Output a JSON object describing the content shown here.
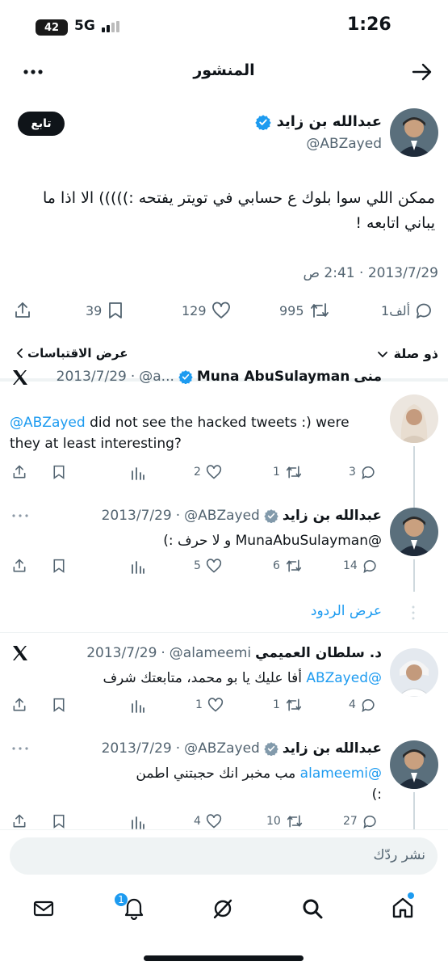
{
  "status_bar": {
    "time": "1:26",
    "battery": "42",
    "network": "5G"
  },
  "header": {
    "title": "المنشور"
  },
  "main_tweet": {
    "author_name": "عبدالله بن زايد",
    "handle": "@ABZayed",
    "follow_label": "تابع",
    "text_line1": "ممكن اللي سوا بلوك ع حسابي في تويتر يفتحه :))))) الا اذا ما",
    "text_line2": "يباني اتابعه !",
    "timestamp": "2013/7/29 · 2:41 ص",
    "replies": "1ألف",
    "retweets": "995",
    "likes": "129",
    "bookmarks": "39",
    "relevance_label": "ذو صلة",
    "quotes_label": "عرض الاقتباسات"
  },
  "replies": [
    {
      "author_name": "منى",
      "author_name_latin": "Muna AbuSulayman",
      "handle": "@a...",
      "date": "2013/7/29",
      "text_mention": "@ABZayed",
      "text_line1": " did not see the hacked tweets :) were",
      "text_line2": "they at least interesting?",
      "replies": "3",
      "retweets": "1",
      "likes": "2"
    },
    {
      "author_name": "عبدالله بن زايد",
      "handle": "@ABZayed",
      "date": "2013/7/29",
      "text": "@MunaAbuSulayman و لا حرف :)",
      "replies": "14",
      "retweets": "6",
      "likes": "5",
      "show_replies": "عرض الردود"
    },
    {
      "author_name": "د. سلطان العميمي",
      "handle": "@alameemi",
      "date": "2013/7/29",
      "text_mention": "@ABZayed",
      "text_rest": " أفا عليك يا بو محمد، متابعتك شرف",
      "replies": "4",
      "retweets": "1",
      "likes": "1"
    },
    {
      "author_name": "عبدالله بن زايد",
      "handle": "@ABZayed",
      "date": "2013/7/29",
      "text_mention": "@alameemi",
      "text_rest": " مب مخبر انك حجبتني اطمن",
      "text_line2": ":)",
      "replies": "27",
      "retweets": "10",
      "likes": "4"
    }
  ],
  "composer": {
    "placeholder": "نشر ردّك"
  },
  "tab_bar": {
    "notifications_badge": "1"
  },
  "colors": {
    "accent": "#1d9bf0",
    "text": "#0f1419",
    "muted": "#536471",
    "verified": "#1d9bf0"
  },
  "icons": [
    "back-arrow-icon",
    "more-icon",
    "verified-icon",
    "x-logo-icon",
    "reply-icon",
    "retweet-icon",
    "like-icon",
    "bookmark-icon",
    "share-icon",
    "views-icon",
    "home-icon",
    "search-icon",
    "grok-icon",
    "notifications-icon",
    "messages-icon"
  ]
}
